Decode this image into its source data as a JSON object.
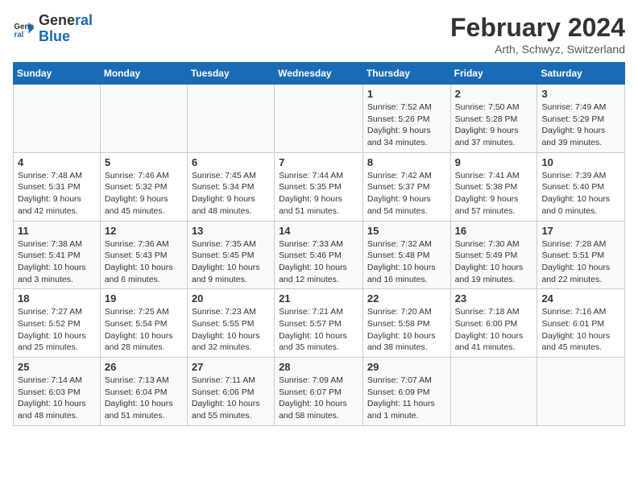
{
  "logo": {
    "text_general": "General",
    "text_blue": "Blue"
  },
  "title": "February 2024",
  "subtitle": "Arth, Schwyz, Switzerland",
  "days_of_week": [
    "Sunday",
    "Monday",
    "Tuesday",
    "Wednesday",
    "Thursday",
    "Friday",
    "Saturday"
  ],
  "weeks": [
    [
      {
        "day": "",
        "info": ""
      },
      {
        "day": "",
        "info": ""
      },
      {
        "day": "",
        "info": ""
      },
      {
        "day": "",
        "info": ""
      },
      {
        "day": "1",
        "info": "Sunrise: 7:52 AM\nSunset: 5:26 PM\nDaylight: 9 hours and 34 minutes."
      },
      {
        "day": "2",
        "info": "Sunrise: 7:50 AM\nSunset: 5:28 PM\nDaylight: 9 hours and 37 minutes."
      },
      {
        "day": "3",
        "info": "Sunrise: 7:49 AM\nSunset: 5:29 PM\nDaylight: 9 hours and 39 minutes."
      }
    ],
    [
      {
        "day": "4",
        "info": "Sunrise: 7:48 AM\nSunset: 5:31 PM\nDaylight: 9 hours and 42 minutes."
      },
      {
        "day": "5",
        "info": "Sunrise: 7:46 AM\nSunset: 5:32 PM\nDaylight: 9 hours and 45 minutes."
      },
      {
        "day": "6",
        "info": "Sunrise: 7:45 AM\nSunset: 5:34 PM\nDaylight: 9 hours and 48 minutes."
      },
      {
        "day": "7",
        "info": "Sunrise: 7:44 AM\nSunset: 5:35 PM\nDaylight: 9 hours and 51 minutes."
      },
      {
        "day": "8",
        "info": "Sunrise: 7:42 AM\nSunset: 5:37 PM\nDaylight: 9 hours and 54 minutes."
      },
      {
        "day": "9",
        "info": "Sunrise: 7:41 AM\nSunset: 5:38 PM\nDaylight: 9 hours and 57 minutes."
      },
      {
        "day": "10",
        "info": "Sunrise: 7:39 AM\nSunset: 5:40 PM\nDaylight: 10 hours and 0 minutes."
      }
    ],
    [
      {
        "day": "11",
        "info": "Sunrise: 7:38 AM\nSunset: 5:41 PM\nDaylight: 10 hours and 3 minutes."
      },
      {
        "day": "12",
        "info": "Sunrise: 7:36 AM\nSunset: 5:43 PM\nDaylight: 10 hours and 6 minutes."
      },
      {
        "day": "13",
        "info": "Sunrise: 7:35 AM\nSunset: 5:45 PM\nDaylight: 10 hours and 9 minutes."
      },
      {
        "day": "14",
        "info": "Sunrise: 7:33 AM\nSunset: 5:46 PM\nDaylight: 10 hours and 12 minutes."
      },
      {
        "day": "15",
        "info": "Sunrise: 7:32 AM\nSunset: 5:48 PM\nDaylight: 10 hours and 16 minutes."
      },
      {
        "day": "16",
        "info": "Sunrise: 7:30 AM\nSunset: 5:49 PM\nDaylight: 10 hours and 19 minutes."
      },
      {
        "day": "17",
        "info": "Sunrise: 7:28 AM\nSunset: 5:51 PM\nDaylight: 10 hours and 22 minutes."
      }
    ],
    [
      {
        "day": "18",
        "info": "Sunrise: 7:27 AM\nSunset: 5:52 PM\nDaylight: 10 hours and 25 minutes."
      },
      {
        "day": "19",
        "info": "Sunrise: 7:25 AM\nSunset: 5:54 PM\nDaylight: 10 hours and 28 minutes."
      },
      {
        "day": "20",
        "info": "Sunrise: 7:23 AM\nSunset: 5:55 PM\nDaylight: 10 hours and 32 minutes."
      },
      {
        "day": "21",
        "info": "Sunrise: 7:21 AM\nSunset: 5:57 PM\nDaylight: 10 hours and 35 minutes."
      },
      {
        "day": "22",
        "info": "Sunrise: 7:20 AM\nSunset: 5:58 PM\nDaylight: 10 hours and 38 minutes."
      },
      {
        "day": "23",
        "info": "Sunrise: 7:18 AM\nSunset: 6:00 PM\nDaylight: 10 hours and 41 minutes."
      },
      {
        "day": "24",
        "info": "Sunrise: 7:16 AM\nSunset: 6:01 PM\nDaylight: 10 hours and 45 minutes."
      }
    ],
    [
      {
        "day": "25",
        "info": "Sunrise: 7:14 AM\nSunset: 6:03 PM\nDaylight: 10 hours and 48 minutes."
      },
      {
        "day": "26",
        "info": "Sunrise: 7:13 AM\nSunset: 6:04 PM\nDaylight: 10 hours and 51 minutes."
      },
      {
        "day": "27",
        "info": "Sunrise: 7:11 AM\nSunset: 6:06 PM\nDaylight: 10 hours and 55 minutes."
      },
      {
        "day": "28",
        "info": "Sunrise: 7:09 AM\nSunset: 6:07 PM\nDaylight: 10 hours and 58 minutes."
      },
      {
        "day": "29",
        "info": "Sunrise: 7:07 AM\nSunset: 6:09 PM\nDaylight: 11 hours and 1 minute."
      },
      {
        "day": "",
        "info": ""
      },
      {
        "day": "",
        "info": ""
      }
    ]
  ]
}
